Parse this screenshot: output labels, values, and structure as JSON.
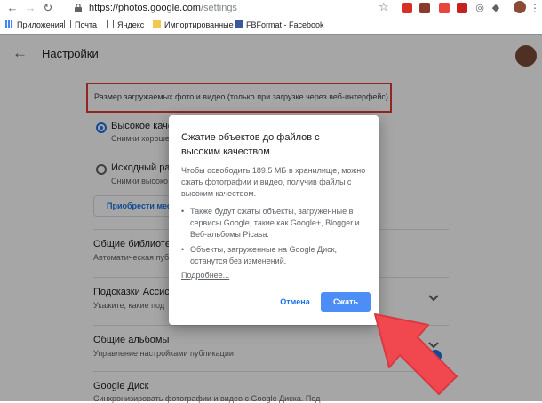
{
  "browser": {
    "url_host": "https://photos.google.com",
    "url_path": "/settings",
    "bookmarks": [
      {
        "label": "Приложения"
      },
      {
        "label": "Почта"
      },
      {
        "label": "Яндекс"
      },
      {
        "label": "Импортированные"
      },
      {
        "label": "FBFormat - Facebook"
      }
    ]
  },
  "header": {
    "title": "Настройки"
  },
  "upload": {
    "label": "Размер загружаемых фото и видео (только при загрузке через веб-интерфейс)",
    "option_high": {
      "title": "Высокое качес",
      "subtitle": "Снимки хороше"
    },
    "option_original": {
      "title": "Исходный ра",
      "subtitle": "Снимки высоко"
    },
    "buy_label": "Приобрести мес"
  },
  "settings": [
    {
      "title": "Общие библиотек",
      "subtitle": "Автоматическая публ"
    },
    {
      "title": "Подсказки Ассист",
      "subtitle": "Укажите, какие под"
    },
    {
      "title": "Общие альбомы",
      "subtitle": "Управление настройками публикации"
    },
    {
      "title": "Google Диск",
      "subtitle": "Синхронизировать фотографии и видео с Google Диска. Под"
    }
  ],
  "dialog": {
    "title": "Сжатие объектов до файлов с высоким качеством",
    "body": "Чтобы освободить 189,5 МБ в хранилище, можно сжать фотографии и видео, получив файлы с высоким качеством.",
    "bullets": [
      "Также будут сжаты объекты, загруженные в сервисы Google, такие как Google+, Blogger и Веб-альбомы Picasa.",
      "Объекты, загруженные на Google Диск, останутся без изменений."
    ],
    "more_link": "Подробнее...",
    "cancel_label": "Отмена",
    "compress_label": "Сжать"
  },
  "colors": {
    "accent": "#1a73e8",
    "annotation": "#f0484e"
  }
}
